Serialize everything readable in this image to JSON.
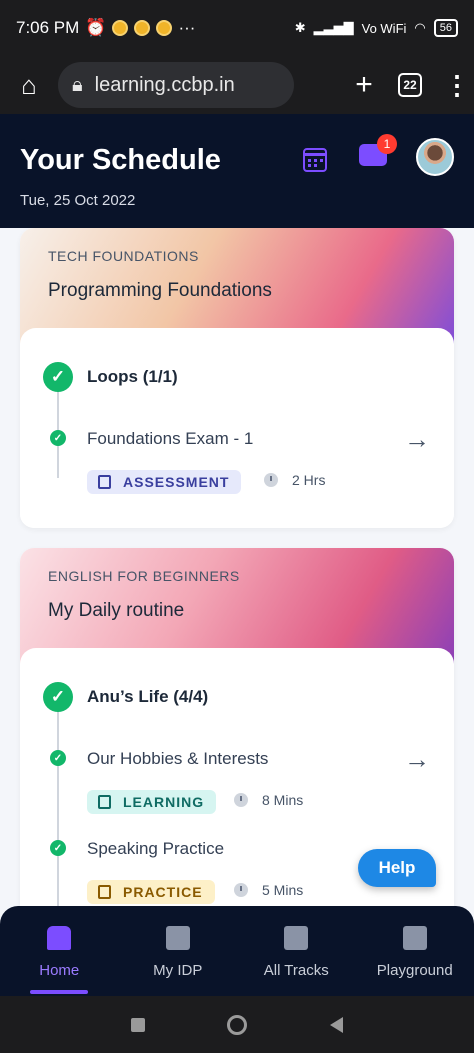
{
  "statusbar": {
    "time": "7:06 PM",
    "network": "Vo WiFi",
    "battery": "56"
  },
  "browser": {
    "url": "learning.ccbp.in",
    "tab_count": "22",
    "icons": [
      "home-icon",
      "lock-icon",
      "plus-icon",
      "tabs-icon",
      "more-icon"
    ]
  },
  "header": {
    "title": "Your Schedule",
    "date": "Tue, 25 Oct 2022",
    "notification_count": "1"
  },
  "cards": [
    {
      "category": "TECH FOUNDATIONS",
      "course": "Programming Foundations",
      "gradient": [
        "#f7f0ea",
        "#f2c6a6",
        "#e96a8a",
        "#7f4dd8"
      ],
      "module": "Loops (1/1)",
      "items": [
        {
          "title": "Foundations Exam - 1",
          "tag": "ASSESSMENT",
          "tag_bg": "#e6e9fb",
          "tag_color": "#3a3f9e",
          "duration": "2 Hrs"
        }
      ]
    },
    {
      "category": "ENGLISH FOR BEGINNERS",
      "course": "My Daily routine",
      "gradient": [
        "#fbe2e6",
        "#f3a7b6",
        "#e05c86",
        "#8b3fb8"
      ],
      "module": "Anu’s Life (4/4)",
      "items": [
        {
          "title": "Our Hobbies & Interests",
          "tag": "LEARNING",
          "tag_bg": "#d6f5f1",
          "tag_color": "#0f6b63",
          "duration": "8 Mins"
        },
        {
          "title": "Speaking Practice",
          "tag": "PRACTICE",
          "tag_bg": "#fdf0c8",
          "tag_color": "#8a5a00",
          "duration": "5 Mins"
        }
      ]
    }
  ],
  "help": {
    "label": "Help"
  },
  "nav": [
    {
      "label": "Home",
      "active": true
    },
    {
      "label": "My IDP"
    },
    {
      "label": "All Tracks"
    },
    {
      "label": "Playground"
    }
  ]
}
